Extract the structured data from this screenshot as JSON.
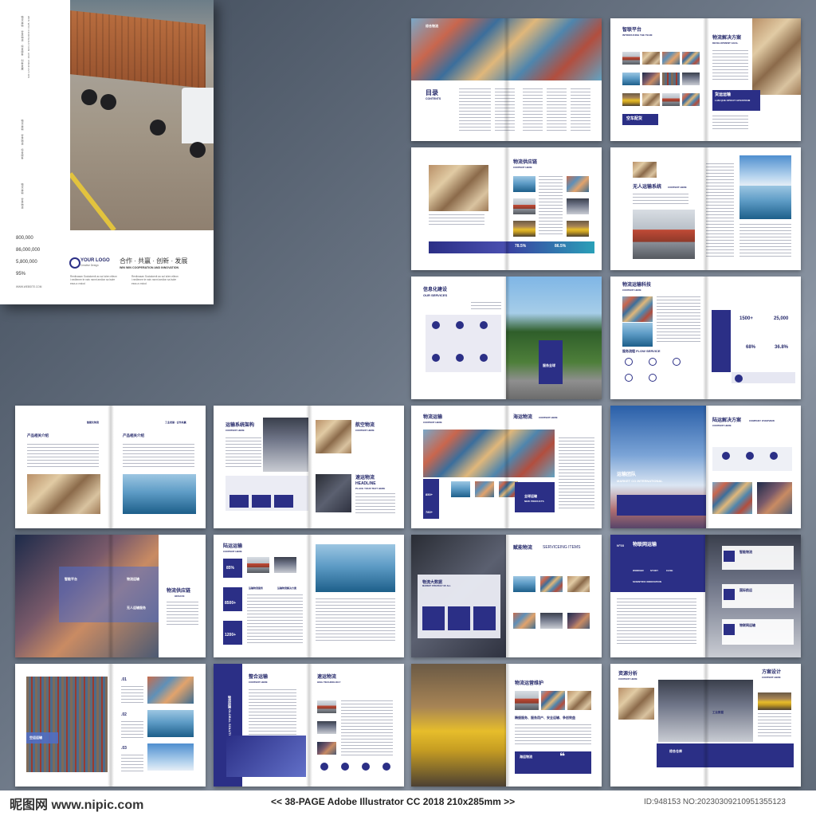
{
  "cover": {
    "logo": "YOUR LOGO",
    "logo_sub": "Creative Design",
    "slogan": "合作 · 共赢 · 创新 · 发展",
    "slogan_en": "WIN WIN COOPERATION AND INNOVATION",
    "website": "WWW.WEBSITE.COM",
    "stats": [
      "800,000",
      "86,000,000",
      "5,800,000",
      "95%"
    ],
    "body_small": "Renlinasan Socialoenit ao sol iolen elleon i nedlenee te naiv nsnnt aedion sa lsdre esss a vroiod"
  },
  "spreads": {
    "s1": {
      "title": "目录",
      "sub": "CONTENTS",
      "photo_label": "综合物流"
    },
    "s2": {
      "title": "智联平台",
      "sub": "INTRODUCING THE TEAM",
      "right_title": "物流解决方案",
      "right_sub": "DEVELOPMENT GOAL",
      "box_title": "货运运输",
      "box_sub": "LAM QUE OPOCIT IATESTRUM",
      "tag": "空车配货"
    },
    "s3": {
      "title": "物流供应链",
      "sub": "CONTENT HERE",
      "pct1": "78.5%",
      "pct2": "86.5%"
    },
    "s4": {
      "title": "无人运输系统",
      "sub": "CONTENT HERE"
    },
    "s5": {
      "title": "信息化建设",
      "sub": "OUR SERVICES",
      "photo_tag": "服务全球"
    },
    "s6": {
      "title": "物流运输科技",
      "sub": "CONTENT HERE",
      "flow": "服务流程 FLOW SERVICE",
      "nums": [
        "1500+",
        "25,000",
        "68%",
        "36.8%"
      ]
    },
    "s7": {
      "title": "产品相关介绍",
      "right_title": "产品相关介绍",
      "header": "智能化物流",
      "header_r": "工业发展  ·  合作共赢"
    },
    "s8": {
      "title": "运输系统架构",
      "sub": "CONTENT HERE",
      "right_title": "航空物流",
      "right_sub": "CONTENT HERE",
      "head2": "速运物流",
      "head2_sub": "HEADLINE",
      "head2_sub2": "PLACE YOUR TEXT HERE"
    },
    "s9": {
      "title": "物流运输",
      "sub": "CONTENT HERE",
      "right_title": "海运物流",
      "right_sub": "CONTENT HERE",
      "nums": [
        "850+",
        "780+"
      ],
      "tag": "全球运输",
      "tag_sub": "NEW PRODUCTS"
    },
    "s10": {
      "title": "陆运解决方案",
      "sub": "CONTENT HERE",
      "title_en": "COMPANY OVERVIEW",
      "photo_title": "运输团队",
      "photo_sub": "MARKET CO INTERNATIONAL"
    },
    "s11": {
      "title": "物流供应链",
      "sub": "HESACE",
      "card1": "智能平台",
      "card2": "物流运输",
      "card3": "无人运输服务"
    },
    "s12": {
      "title": "陆运运输",
      "sub": "CONTENT HERE",
      "nums": [
        "85%",
        "8500+",
        "1200+"
      ],
      "cap1": "运输物流服务",
      "cap2": "运输物流解决方案"
    },
    "s13": {
      "title": "物流大数据",
      "sub": "MARKET STRATEGY OF ALL",
      "right_title": "赋能物流",
      "right_en": "SERVICEING ITEMS"
    },
    "s14": {
      "no": "N°03",
      "title": "物联网运输",
      "sub": "SCIENTIFIC INNOVATION",
      "words": [
        "WORKER",
        "STUDY",
        "CASE"
      ],
      "box1": "智能物流",
      "box2": "国际航运",
      "box3": "物联网运输"
    },
    "s15": {
      "nums": [
        ".01",
        ".02",
        ".03"
      ],
      "label": "空运运输"
    },
    "s16": {
      "title": "整合运输",
      "sub": "CONTENT HERE",
      "vert": "物流运输 GLOBAL SOLUTION",
      "right_title": "速运物流",
      "right_sub": "HIGH TECHNOLOGY"
    },
    "s17": {
      "title": "物流运营维护",
      "words": "精细服务、服务用户、安全运输、争创效益",
      "box": "海运物流"
    },
    "s18": {
      "title": "资源分析",
      "sub": "CONTENT HERE",
      "right_title": "方案设计",
      "right_sub": "CONTENT HERE",
      "tag": "工业数据",
      "b1": "综合仓库",
      "b2": "仓储物流"
    }
  },
  "footer": {
    "site": "昵图网 www.nipic.com",
    "middle": "<< 38-PAGE  Adobe Illustrator CC 2018  210x285mm >>",
    "id": "ID:948153 NO:20230309210951355123"
  }
}
